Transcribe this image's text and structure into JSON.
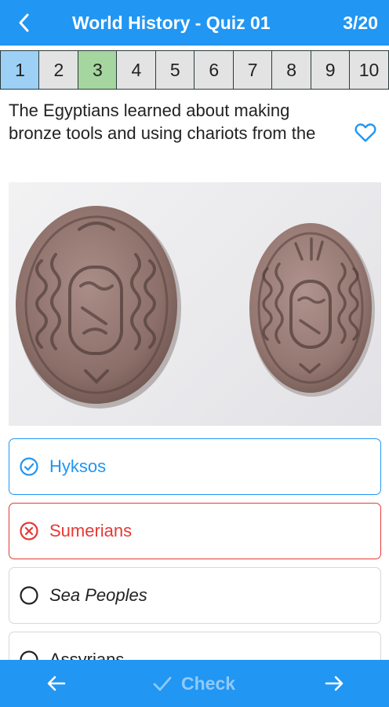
{
  "header": {
    "title": "World History - Quiz 01",
    "progress": "3/20",
    "back_icon": "chevron-left-icon"
  },
  "question_nav": [
    "1",
    "2",
    "3",
    "4",
    "5",
    "6",
    "7",
    "8",
    "9",
    "10"
  ],
  "question": {
    "text": "The Egyptians learned about making bronze tools and using chariots from the",
    "favorite_icon": "heart-outline-icon"
  },
  "image": {
    "subject": "two-carved-scarab-seals-photo"
  },
  "options": [
    {
      "label": "Hyksos",
      "state": "correct",
      "icon": "check-circle-icon"
    },
    {
      "label": "Sumerians",
      "state": "wrong",
      "icon": "x-circle-icon"
    },
    {
      "label": "Sea Peoples",
      "state": "neutral",
      "icon": "radio-empty-icon"
    },
    {
      "label": "Assyrians",
      "state": "neutral",
      "icon": "radio-empty-icon"
    }
  ],
  "footer": {
    "check_label": "Check",
    "prev_icon": "arrow-left-icon",
    "next_icon": "arrow-right-icon"
  },
  "colors": {
    "primary": "#2196f3",
    "correct": "#2196f3",
    "wrong": "#e53935",
    "current_question": "#9dd0f5",
    "answered_question": "#a6d69f"
  }
}
